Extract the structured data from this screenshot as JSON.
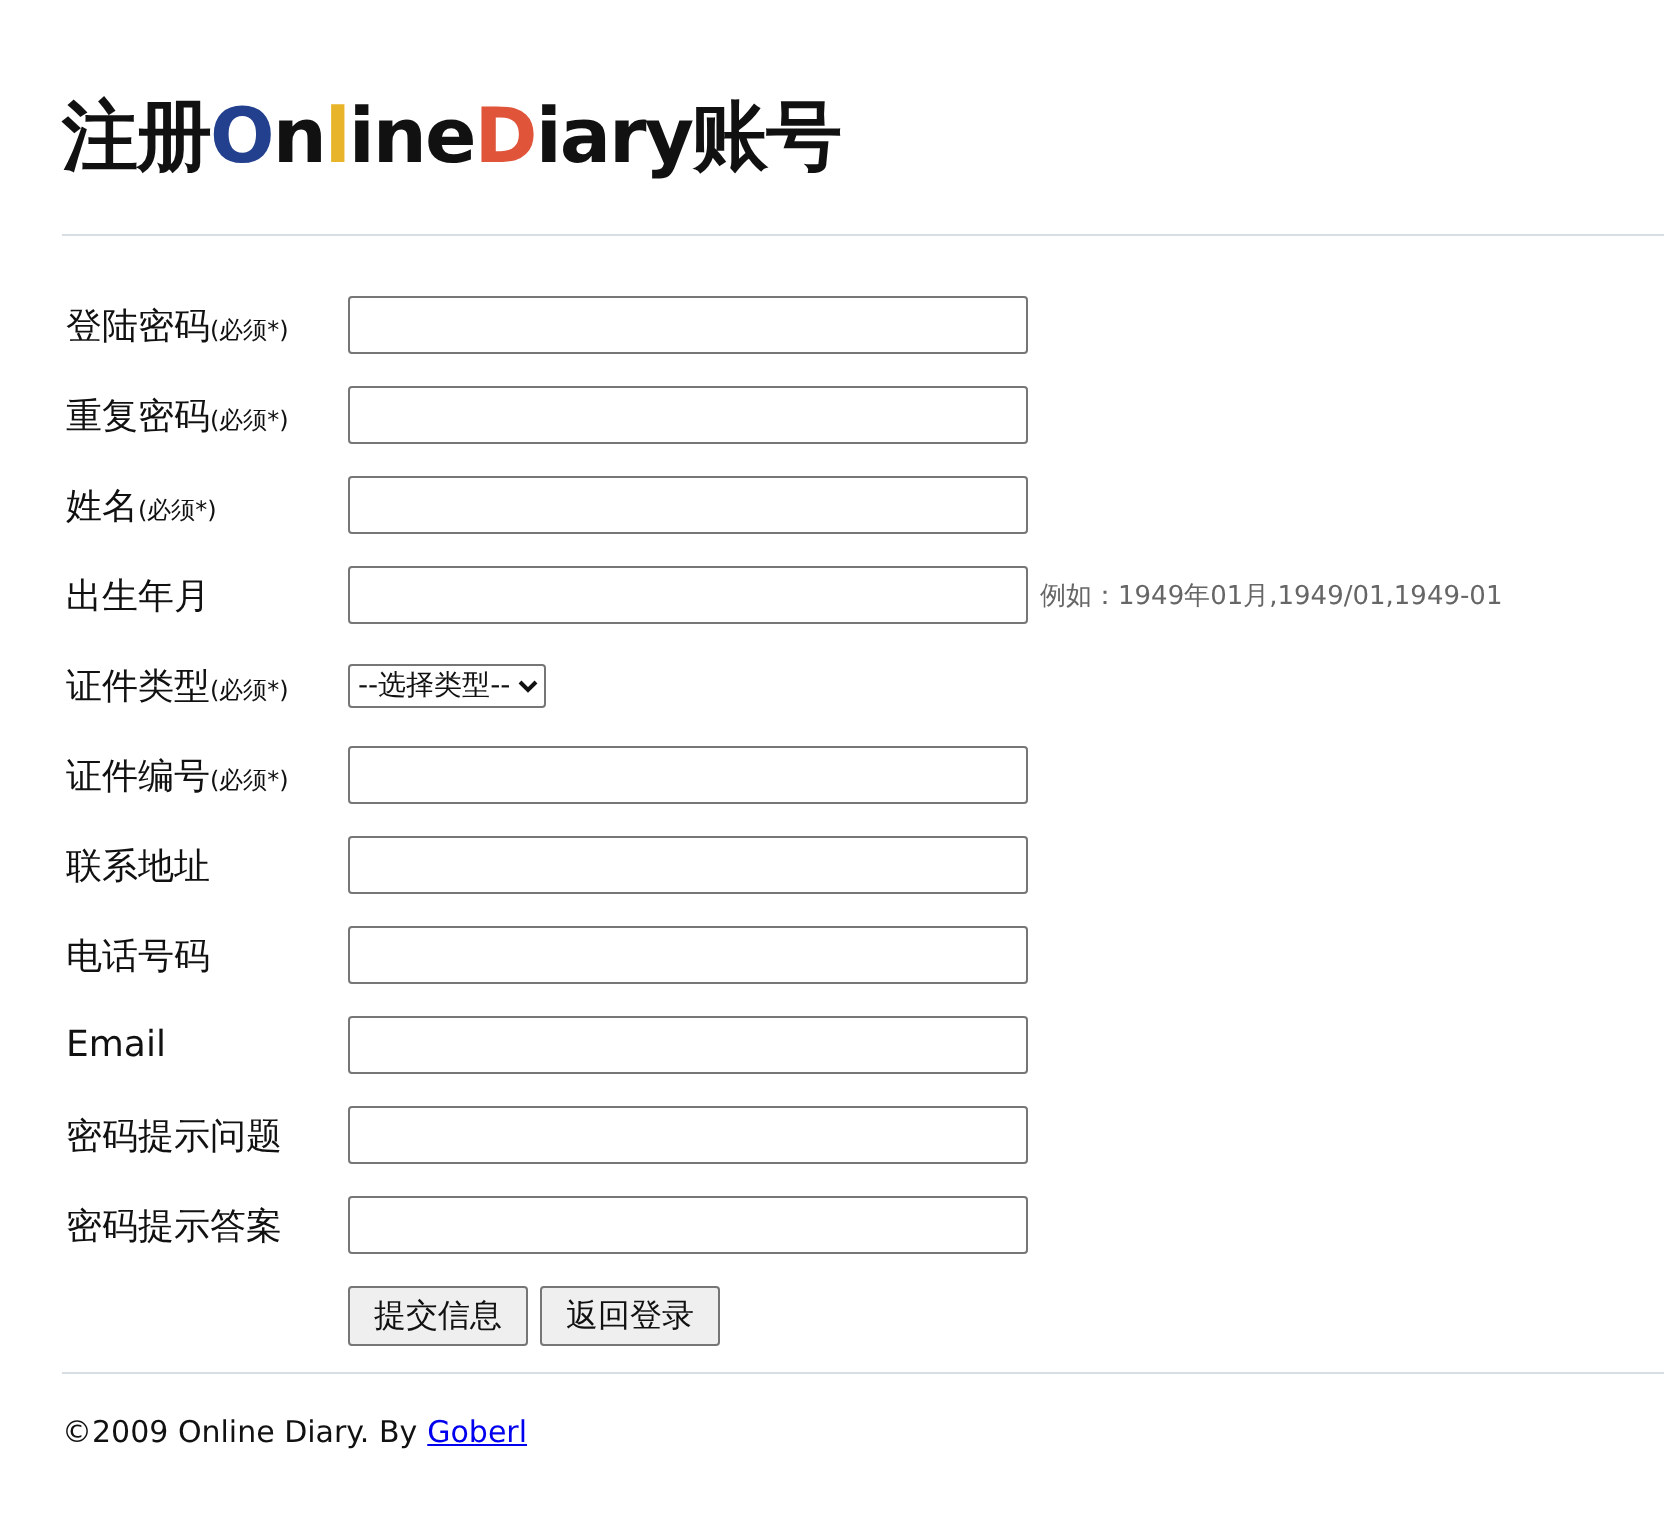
{
  "title": {
    "segments": [
      {
        "text": "注册",
        "color": "#111111"
      },
      {
        "text": "O",
        "color": "#23408e"
      },
      {
        "text": "n",
        "color": "#111111"
      },
      {
        "text": "l",
        "color": "#e8b52a"
      },
      {
        "text": "ine",
        "color": "#111111"
      },
      {
        "text": "D",
        "color": "#e0553a"
      },
      {
        "text": "iary账号",
        "color": "#111111"
      }
    ]
  },
  "fields": [
    {
      "kind": "text",
      "label": "登陆密码",
      "note": "(必须*)"
    },
    {
      "kind": "text",
      "label": "重复密码",
      "note": "(必须*)"
    },
    {
      "kind": "text",
      "label": "姓名",
      "note": "(必须*)"
    },
    {
      "kind": "text",
      "label": "出生年月",
      "hint": "例如：1949年01月,1949/01,1949-01"
    },
    {
      "kind": "select",
      "label": "证件类型",
      "note": "(必须*)",
      "value": "--选择类型--"
    },
    {
      "kind": "text",
      "label": "证件编号",
      "note": "(必须*)"
    },
    {
      "kind": "text",
      "label": "联系地址"
    },
    {
      "kind": "text",
      "label": "电话号码"
    },
    {
      "kind": "text",
      "label": "Email"
    },
    {
      "kind": "text",
      "label": "密码提示问题"
    },
    {
      "kind": "text",
      "label": "密码提示答案"
    }
  ],
  "buttons": [
    "提交信息",
    "返回登录"
  ],
  "footer": {
    "text": "©2009 Online Diary. By",
    "link": "Goberl"
  }
}
